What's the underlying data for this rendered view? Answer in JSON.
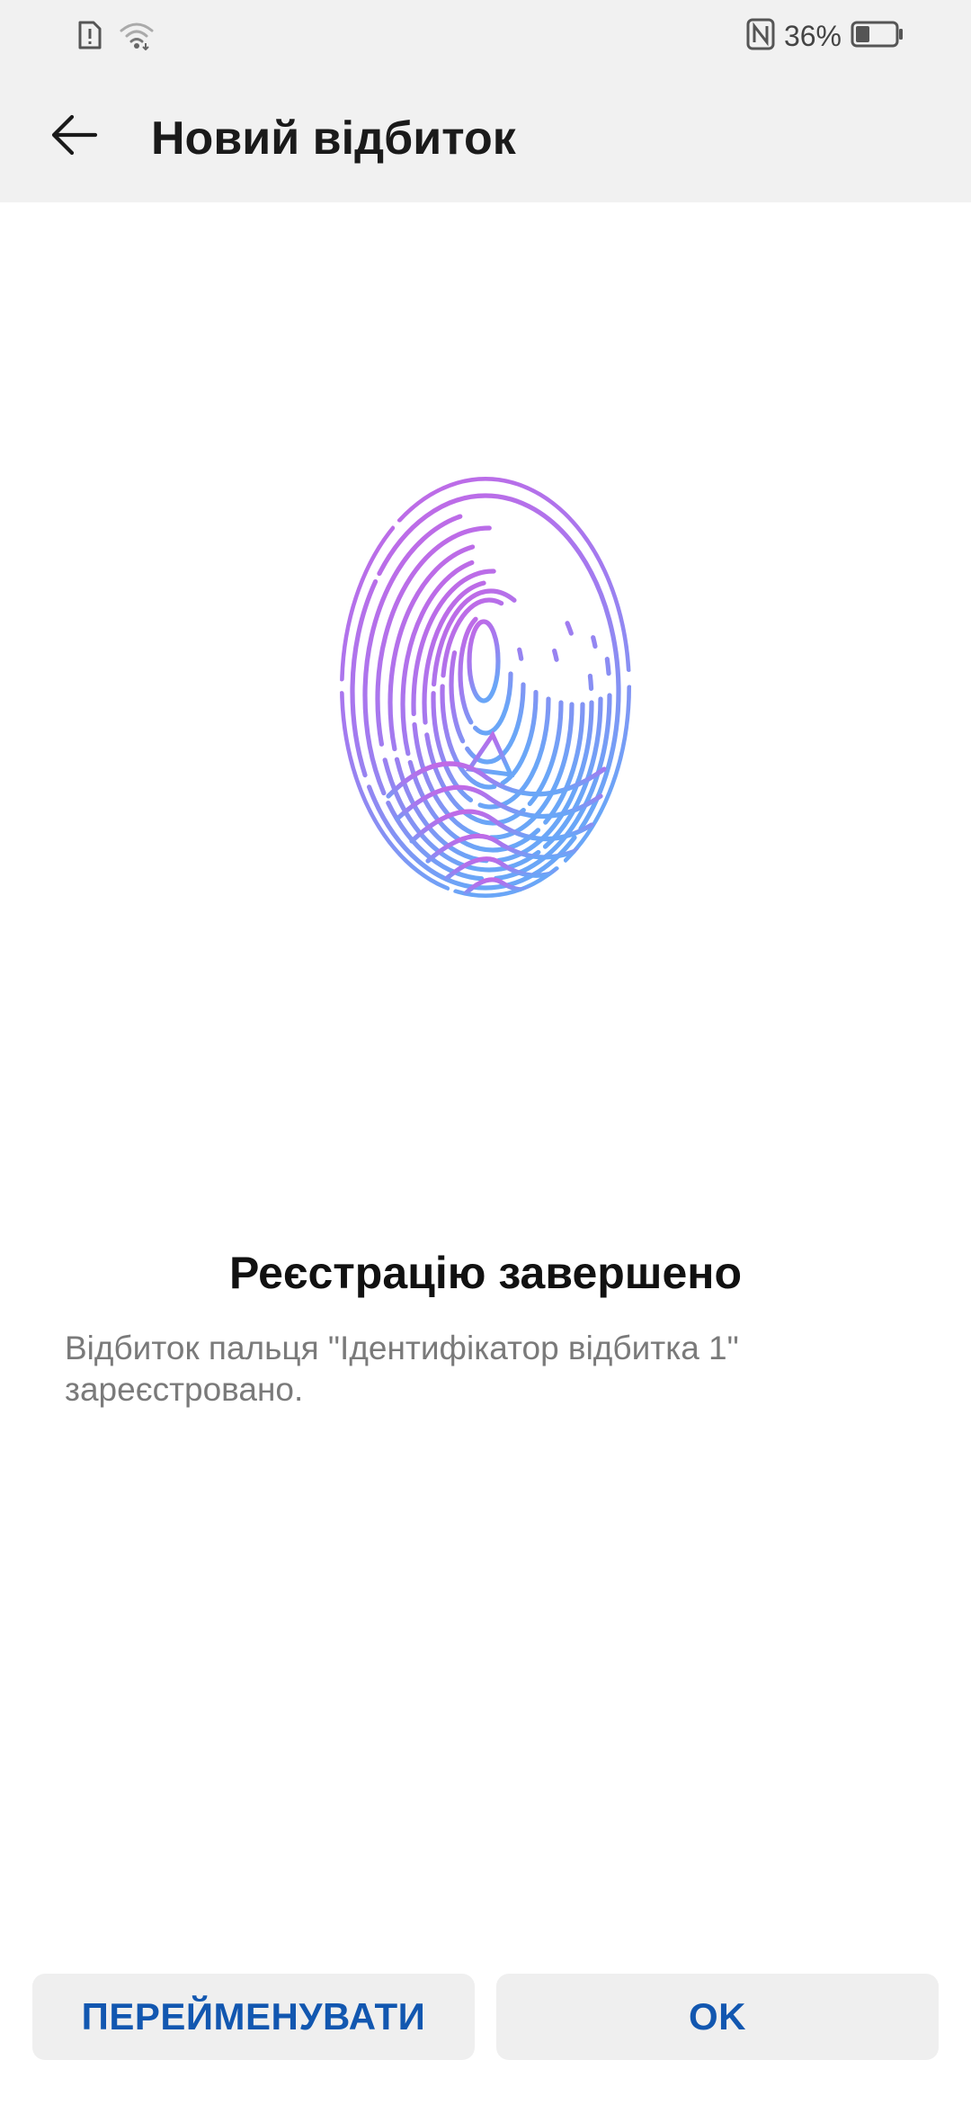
{
  "status_bar": {
    "battery_percent": "36%",
    "battery_level": 0.36,
    "icons": [
      "sim-alert-icon",
      "wifi-icon",
      "nfc-icon",
      "battery-icon"
    ]
  },
  "header": {
    "title": "Новий відбиток"
  },
  "main": {
    "fingerprint_icon": "fingerprint-icon",
    "gradient_colors": [
      "#c766e4",
      "#a479ef",
      "#6aa6f7"
    ],
    "success_title": "Реєстрацію завершено",
    "success_description": "Відбиток пальця \"Ідентифікатор відбитка 1\" зареєстровано."
  },
  "actions": {
    "rename_label": "ПЕРЕЙМЕНУВАТИ",
    "ok_label": "OK",
    "accent_color": "#1257b0"
  }
}
